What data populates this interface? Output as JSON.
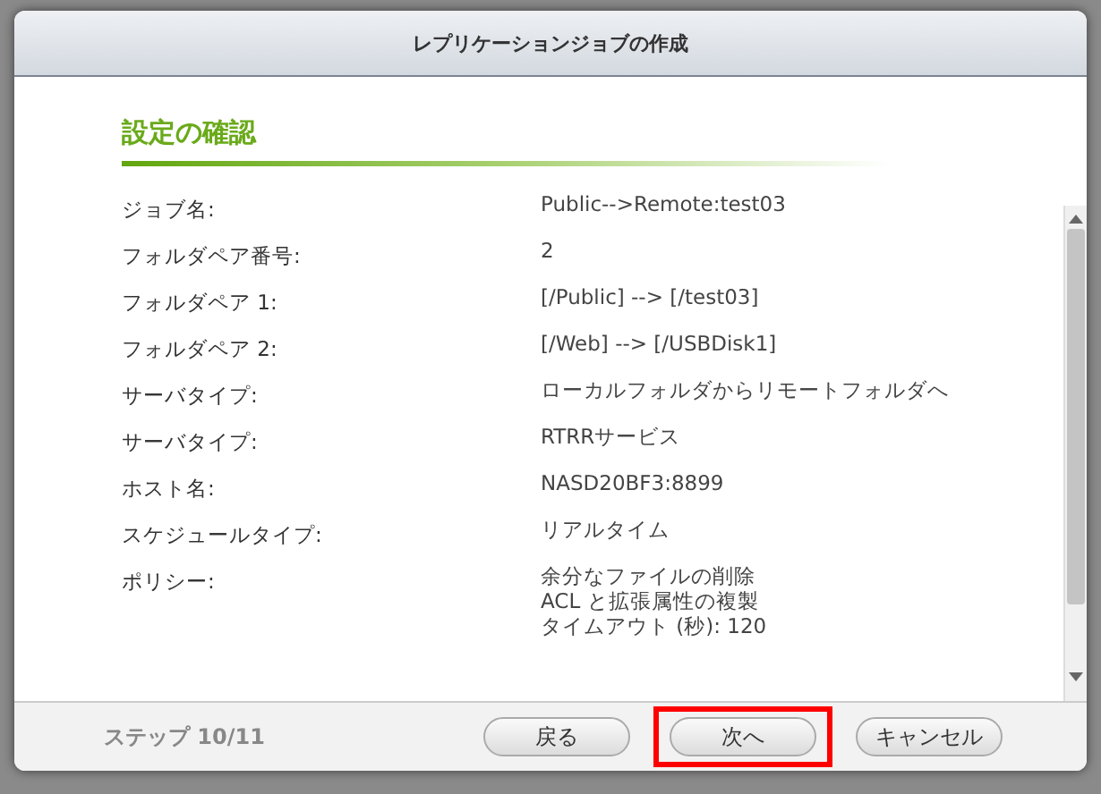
{
  "window": {
    "title": "レプリケーションジョブの作成"
  },
  "section": {
    "title": "設定の確認"
  },
  "rows": [
    {
      "label": "ジョブ名:",
      "values": [
        "Public-->Remote:test03"
      ]
    },
    {
      "label": "フォルダペア番号:",
      "values": [
        "2"
      ]
    },
    {
      "label": "フォルダペア 1:",
      "values": [
        "[/Public] --> [/test03]"
      ]
    },
    {
      "label": "フォルダペア 2:",
      "values": [
        "[/Web] --> [/USBDisk1]"
      ]
    },
    {
      "label": "サーバタイプ:",
      "values": [
        "ローカルフォルダからリモートフォルダへ"
      ]
    },
    {
      "label": "サーバタイプ:",
      "values": [
        "RTRRサービス"
      ]
    },
    {
      "label": "ホスト名:",
      "values": [
        "NASD20BF3:8899"
      ]
    },
    {
      "label": "スケジュールタイプ:",
      "values": [
        "リアルタイム"
      ]
    },
    {
      "label": "ポリシー:",
      "values": [
        "余分なファイルの削除",
        "ACL と拡張属性の複製",
        "タイムアウト (秒): 120"
      ]
    }
  ],
  "footer": {
    "step": "ステップ 10/11",
    "buttons": [
      {
        "label": "戻る",
        "highlighted": false
      },
      {
        "label": "次へ",
        "highlighted": true
      },
      {
        "label": "キャンセル",
        "highlighted": false
      }
    ]
  }
}
